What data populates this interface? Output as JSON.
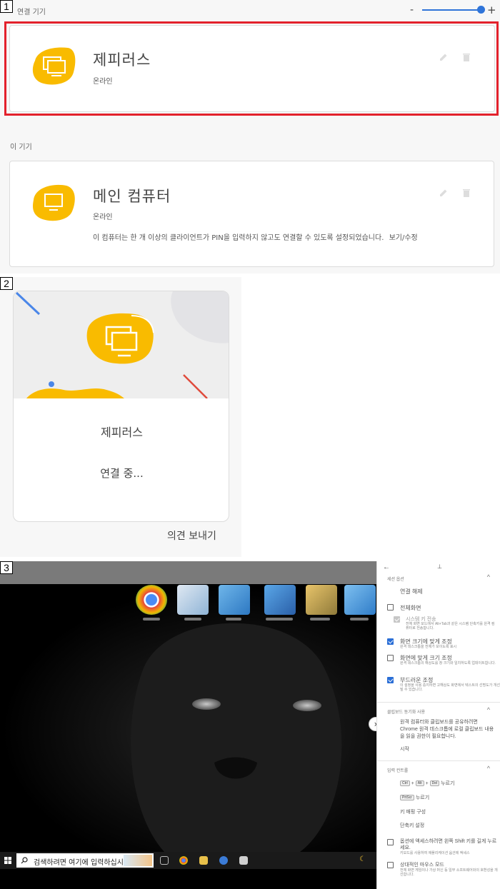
{
  "panels": [
    "1",
    "2",
    "3"
  ],
  "remote_list": {
    "section_remote": "연결 기기",
    "zoom": {
      "minus": "-",
      "plus": "+",
      "level": 1.0
    },
    "devices": [
      {
        "name": "제피러스",
        "status": "온라인"
      },
      {
        "name": "메인 컴퓨터",
        "status": "온라인",
        "note": "이 컴퓨터는 한 개 이상의 클라이언트가 PIN을 입력하지 않고도 연결할 수 있도록 설정되었습니다.",
        "note_link": "보기/수정"
      }
    ],
    "section_this": "이 기기",
    "colors": {
      "accent": "#F9BB00",
      "highlight": "#E3212C",
      "slider": "#2F74D9"
    }
  },
  "connecting": {
    "name": "제피러스",
    "status": "연결 중...",
    "feedback": "의견 보내기"
  },
  "session": {
    "taskbar_search": "검색하려면 여기에 입력하십시",
    "desktop_icons": [
      "chrome-icon",
      "document-icon",
      "photo-icon",
      "folder-icon",
      "user-folder-icon",
      "network-icon"
    ],
    "sidebar": {
      "back": "←",
      "pin": "⊥",
      "session_options": "세션 옵션",
      "disconnect": "연결 해제",
      "fullscreen": "전체화면",
      "system_keys": "시스템 키 전송",
      "system_keys_desc": "전체 화면 모드에서 Alt+Tab과 같은 시스템 단축키를 원격 컴퓨터로 전송합니다.",
      "fit_screen": "화면 크기에 맞게 조정",
      "fit_screen_desc": "원격 데스크톱을 전체가 보이도록 표시",
      "resize": "화면에 맞게 크기 조정",
      "resize_desc": "원격 데스크톱의 해상도를 창 크기와 일치하도록 업데이트합니다.",
      "smooth": "부드러운 조정",
      "smooth_desc": "이 설정을 사용 중지하면 고해상도 화면에서 텍스트의 선명도가 개선될 수 있습니다.",
      "clipboard_head": "클립보드 동기화 사용",
      "clipboard_desc": "원격 컴퓨터와 클립보드를 공유하려면 Chrome 원격 데스크톱에 로컬 클립보드 내용을 읽을 권한이 필요합니다.",
      "start": "시작",
      "input_head": "입력 컨트롤",
      "key_ctrl": "Ctrl",
      "key_alt": "Alt",
      "key_del": "Del",
      "plus": "+",
      "press": "누르기",
      "key_prtscr": "PrtScr",
      "key_mapping": "키 매핑 구성",
      "shortcuts": "단축키 설정",
      "shift_hold": "옵션에 액세스하려면 왼쪽 Shift 키를 길게 누르세요.",
      "shift_desc": "키보드를 사용하여 애플리케이션 옵션에 액세스",
      "relative_mouse": "상대적인 마우스 모드",
      "relative_mouse_desc": "전체 화면 게임이나 가상 머신 등 일부 소프트웨어와의 호환성을 개선합니다.",
      "chevron": "^",
      "expand": "›"
    }
  }
}
